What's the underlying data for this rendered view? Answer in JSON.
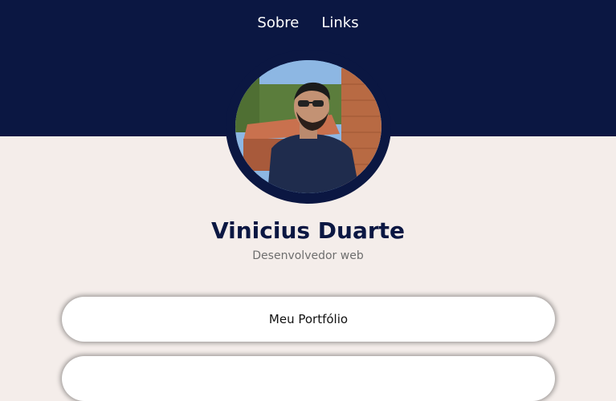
{
  "nav": {
    "items": [
      {
        "label": "Sobre"
      },
      {
        "label": "Links"
      }
    ]
  },
  "profile": {
    "name": "Vinicius Duarte",
    "role": "Desenvolvedor web",
    "avatar_icon": "profile-photo"
  },
  "links": [
    {
      "label": "Meu Portfólio"
    },
    {
      "label": ""
    }
  ],
  "colors": {
    "header_bg": "#0b1742",
    "page_bg": "#f4edea",
    "name_color": "#0b1742"
  }
}
